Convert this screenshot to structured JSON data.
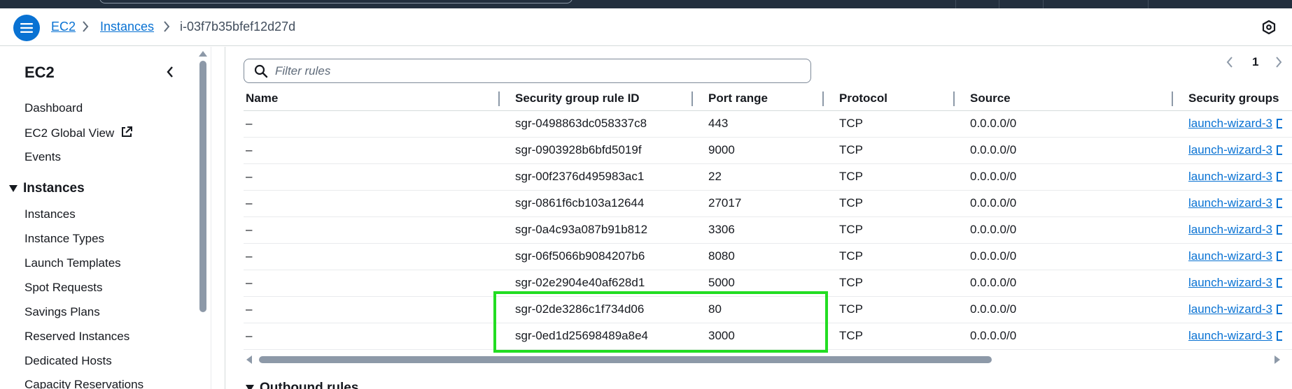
{
  "breadcrumb": {
    "items": [
      "EC2",
      "Instances"
    ],
    "current": "i-03f7b35bfef12d27d"
  },
  "sidebar": {
    "title": "EC2",
    "top_items": [
      "Dashboard",
      "EC2 Global View",
      "Events"
    ],
    "section": "Instances",
    "section_items": [
      "Instances",
      "Instance Types",
      "Launch Templates",
      "Spot Requests",
      "Savings Plans",
      "Reserved Instances",
      "Dedicated Hosts",
      "Capacity Reservations"
    ]
  },
  "filter": {
    "placeholder": "Filter rules"
  },
  "pagination": {
    "page": "1"
  },
  "table": {
    "columns": [
      "Name",
      "Security group rule ID",
      "Port range",
      "Protocol",
      "Source",
      "Security groups"
    ],
    "rows": [
      {
        "name": "–",
        "rule_id": "sgr-0498863dc058337c8",
        "port": "443",
        "protocol": "TCP",
        "source": "0.0.0.0/0",
        "group": "launch-wizard-3"
      },
      {
        "name": "–",
        "rule_id": "sgr-0903928b6bfd5019f",
        "port": "9000",
        "protocol": "TCP",
        "source": "0.0.0.0/0",
        "group": "launch-wizard-3"
      },
      {
        "name": "–",
        "rule_id": "sgr-00f2376d495983ac1",
        "port": "22",
        "protocol": "TCP",
        "source": "0.0.0.0/0",
        "group": "launch-wizard-3"
      },
      {
        "name": "–",
        "rule_id": "sgr-0861f6cb103a12644",
        "port": "27017",
        "protocol": "TCP",
        "source": "0.0.0.0/0",
        "group": "launch-wizard-3"
      },
      {
        "name": "–",
        "rule_id": "sgr-0a4c93a087b91b812",
        "port": "3306",
        "protocol": "TCP",
        "source": "0.0.0.0/0",
        "group": "launch-wizard-3"
      },
      {
        "name": "–",
        "rule_id": "sgr-06f5066b9084207b6",
        "port": "8080",
        "protocol": "TCP",
        "source": "0.0.0.0/0",
        "group": "launch-wizard-3"
      },
      {
        "name": "–",
        "rule_id": "sgr-02e2904e40af628d1",
        "port": "5000",
        "protocol": "TCP",
        "source": "0.0.0.0/0",
        "group": "launch-wizard-3"
      },
      {
        "name": "–",
        "rule_id": "sgr-02de3286c1f734d06",
        "port": "80",
        "protocol": "TCP",
        "source": "0.0.0.0/0",
        "group": "launch-wizard-3"
      },
      {
        "name": "–",
        "rule_id": "sgr-0ed1d25698489a8e4",
        "port": "3000",
        "protocol": "TCP",
        "source": "0.0.0.0/0",
        "group": "launch-wizard-3"
      }
    ]
  },
  "next_section": {
    "label": "Outbound rules"
  },
  "colors": {
    "accent": "#0972d3",
    "highlight": "#22dd22",
    "header_bg": "#232f3e"
  }
}
